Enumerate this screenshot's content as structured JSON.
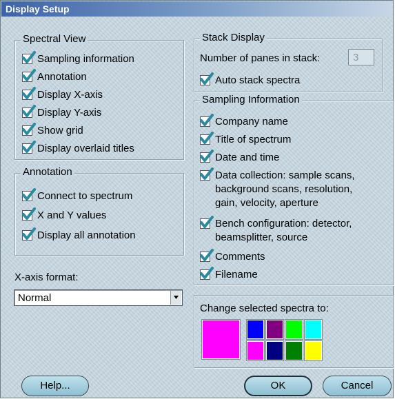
{
  "window": {
    "title": "Display Setup"
  },
  "spectral_view": {
    "legend": "Spectral View",
    "items": [
      {
        "label": "Sampling information",
        "checked": true
      },
      {
        "label": "Annotation",
        "checked": true
      },
      {
        "label": "Display X-axis",
        "checked": true
      },
      {
        "label": "Display Y-axis",
        "checked": true
      },
      {
        "label": "Show grid",
        "checked": true
      },
      {
        "label": "Display overlaid titles",
        "checked": true
      }
    ]
  },
  "annotation": {
    "legend": "Annotation",
    "items": [
      {
        "label": "Connect to spectrum",
        "checked": true
      },
      {
        "label": "X and Y values",
        "checked": true
      },
      {
        "label": "Display all annotation",
        "checked": true
      }
    ]
  },
  "xaxis_format": {
    "label": "X-axis format:",
    "value": "Normal"
  },
  "stack_display": {
    "legend": "Stack Display",
    "panes_label": "Number of panes in stack:",
    "panes_value": "3",
    "auto_stack_label": "Auto stack spectra",
    "auto_stack_checked": true
  },
  "sampling_information": {
    "legend": "Sampling Information",
    "items": [
      {
        "label": "Company name",
        "checked": true
      },
      {
        "label": "Title of spectrum",
        "checked": true
      },
      {
        "label": "Date and time",
        "checked": true
      },
      {
        "label": "Data collection: sample scans,\nbackground scans, resolution,\ngain, velocity, aperture",
        "checked": true
      },
      {
        "label": "Bench configuration: detector,\nbeamsplitter, source",
        "checked": true
      },
      {
        "label": "Comments",
        "checked": true
      },
      {
        "label": "Filename",
        "checked": true
      }
    ]
  },
  "color_panel": {
    "label": "Change selected spectra to:",
    "selected_color": "#ff00ff",
    "palette": [
      "#0000ff",
      "#800080",
      "#00ff00",
      "#00ffff",
      "#ff00ff",
      "#000080",
      "#008000",
      "#ffff00"
    ]
  },
  "buttons": {
    "help": "Help...",
    "ok": "OK",
    "cancel": "Cancel"
  },
  "colors": {
    "check": "#2a8aa0",
    "title_bar": "#3d63a8",
    "panel_bg": "#c6d7e1"
  }
}
